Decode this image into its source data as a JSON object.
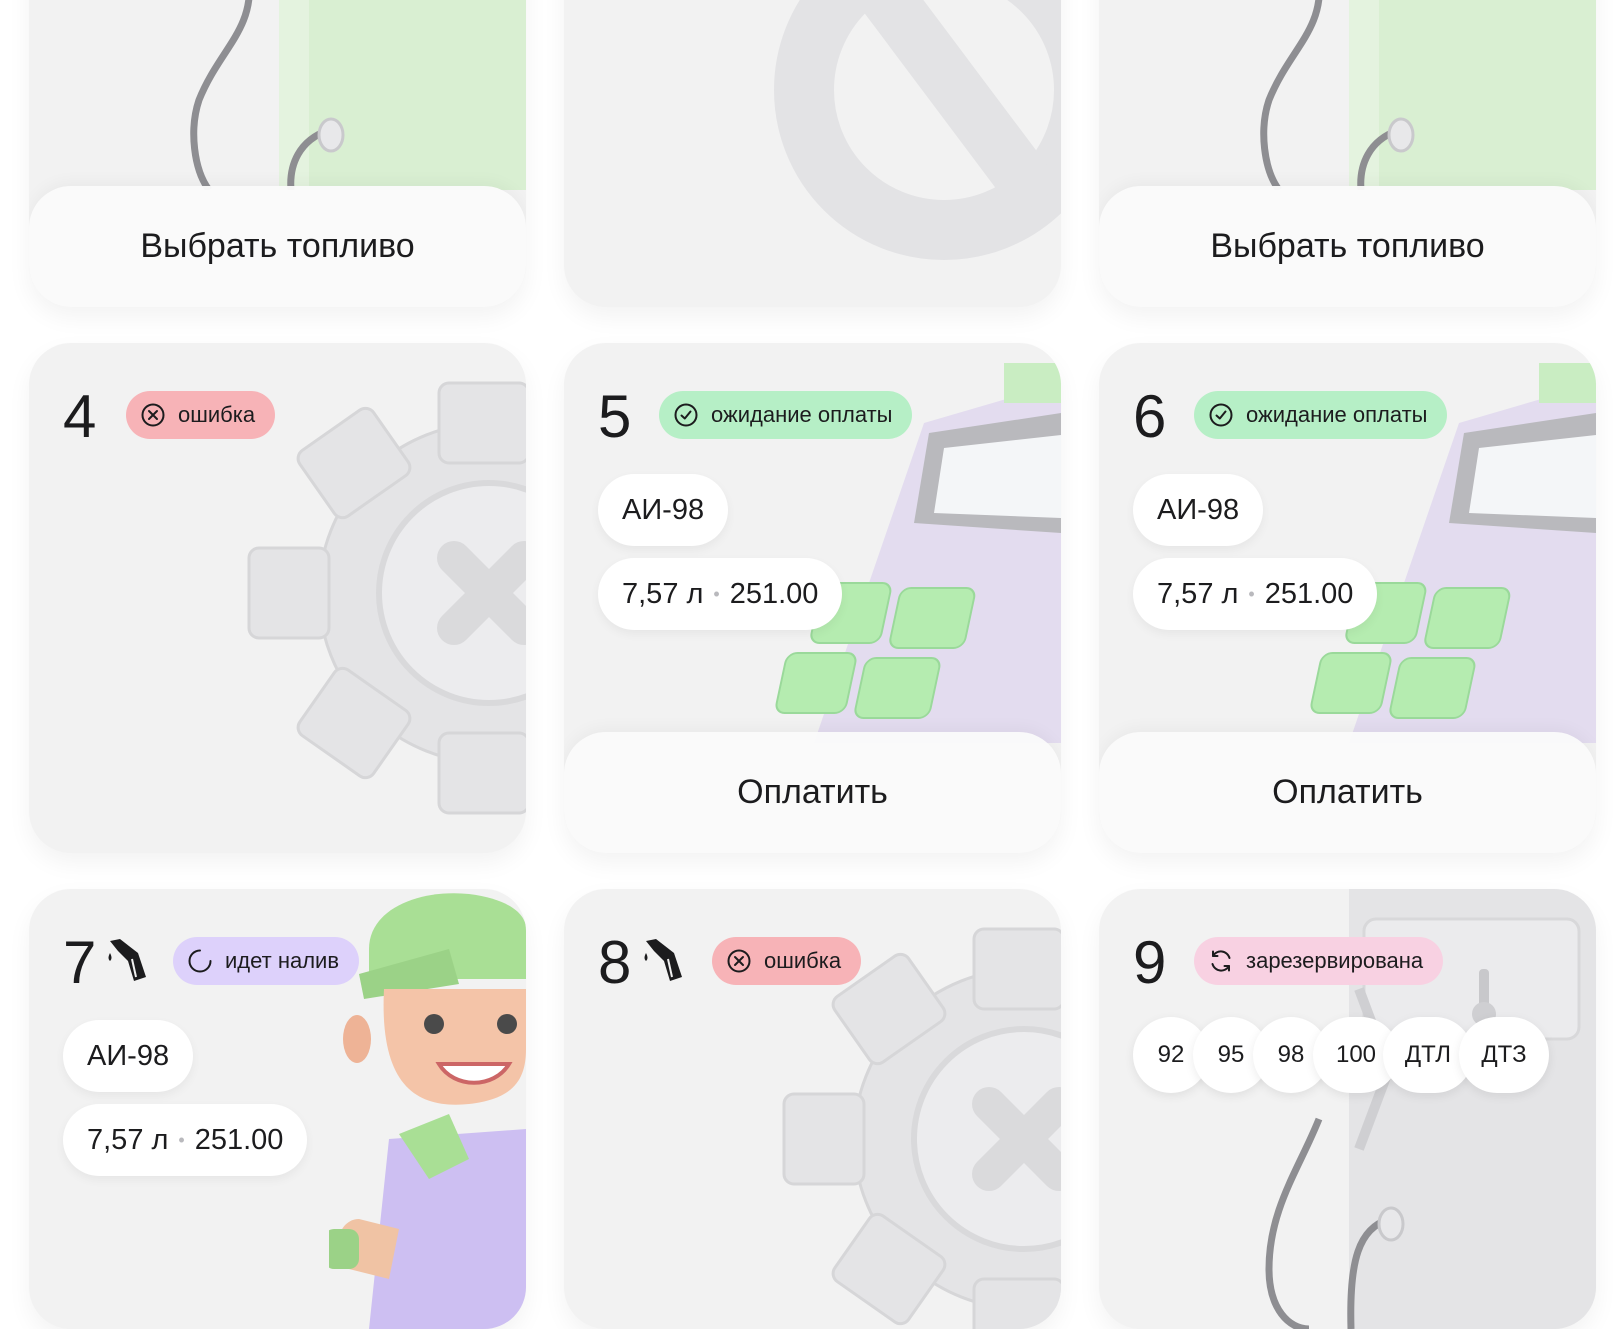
{
  "top_row": {
    "card1": {
      "action_label": "Выбрать топливо"
    },
    "card2": {
      "state": "blocked"
    },
    "card3": {
      "action_label": "Выбрать топливо"
    }
  },
  "pumps": [
    {
      "number": "4",
      "status": "ошибка",
      "status_icon": "error-circle-x-icon",
      "status_color": "#f7b3b7"
    },
    {
      "number": "5",
      "status": "ожидание оплаты",
      "status_icon": "check-circle-icon",
      "status_color": "#b6efc6",
      "fuel": "АИ-98",
      "volume": "7,57 л",
      "amount": "251.00",
      "action_label": "Оплатить"
    },
    {
      "number": "6",
      "status": "ожидание оплаты",
      "status_icon": "check-circle-icon",
      "status_color": "#b6efc6",
      "fuel": "АИ-98",
      "volume": "7,57 л",
      "amount": "251.00",
      "action_label": "Оплатить"
    },
    {
      "number": "7",
      "status": "идет налив",
      "status_icon": "spinner-icon",
      "status_color": "#ddd1fb",
      "nozzle_icon": "fuel-nozzle-icon",
      "fuel": "АИ-98",
      "volume": "7,57 л",
      "amount": "251.00"
    },
    {
      "number": "8",
      "status": "ошибка",
      "status_icon": "error-circle-x-icon",
      "status_color": "#f7b3b7",
      "nozzle_icon": "fuel-nozzle-icon"
    },
    {
      "number": "9",
      "status": "зарезервирована",
      "status_icon": "refresh-icon",
      "status_color": "#f8d1e2",
      "fuel_options": [
        "92",
        "95",
        "98",
        "100",
        "ДТЛ",
        "ДТЗ"
      ]
    }
  ]
}
